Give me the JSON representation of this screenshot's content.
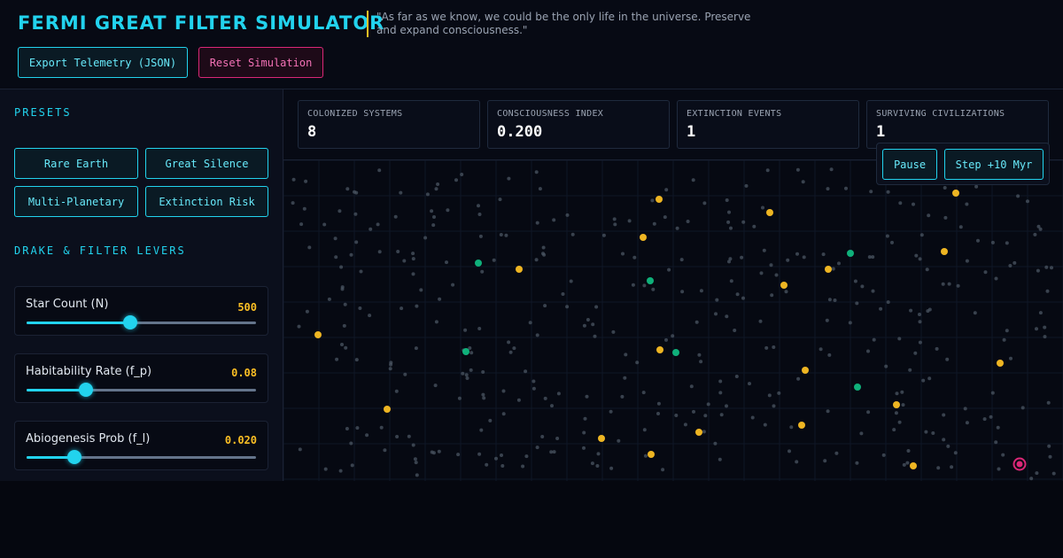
{
  "header": {
    "title": "FERMI GREAT FILTER SIMULATOR",
    "quote": "\"As far as we know, we could be the only life in the universe. Preserve and expand consciousness.\"",
    "export_label": "Export Telemetry (JSON)",
    "reset_label": "Reset Simulation"
  },
  "sidebar": {
    "presets_title": "PRESETS",
    "presets": [
      "Rare Earth",
      "Great Silence",
      "Multi-Planetary",
      "Extinction Risk"
    ],
    "levers_title": "DRAKE & FILTER LEVERS",
    "levers": [
      {
        "label": "Star Count (N)",
        "value": "500",
        "fraction": 0.45
      },
      {
        "label": "Habitability Rate (f_p)",
        "value": "0.08",
        "fraction": 0.26
      },
      {
        "label": "Abiogenesis Prob (f_l)",
        "value": "0.020",
        "fraction": 0.21
      }
    ]
  },
  "stats": [
    {
      "label": "COLONIZED SYSTEMS",
      "value": "8"
    },
    {
      "label": "CONSCIOUSNESS INDEX",
      "value": "0.200"
    },
    {
      "label": "EXTINCTION EVENTS",
      "value": "1"
    },
    {
      "label": "SURVIVING CIVILIZATIONS",
      "value": "1"
    }
  ],
  "controls": {
    "pause_label": "Pause",
    "step_label": "Step +10 Myr"
  },
  "colors": {
    "accent": "#22d3ee",
    "warning": "#fbbf24",
    "danger": "#db2777",
    "life": "#10b981",
    "dormant_star": "#4b5563"
  }
}
